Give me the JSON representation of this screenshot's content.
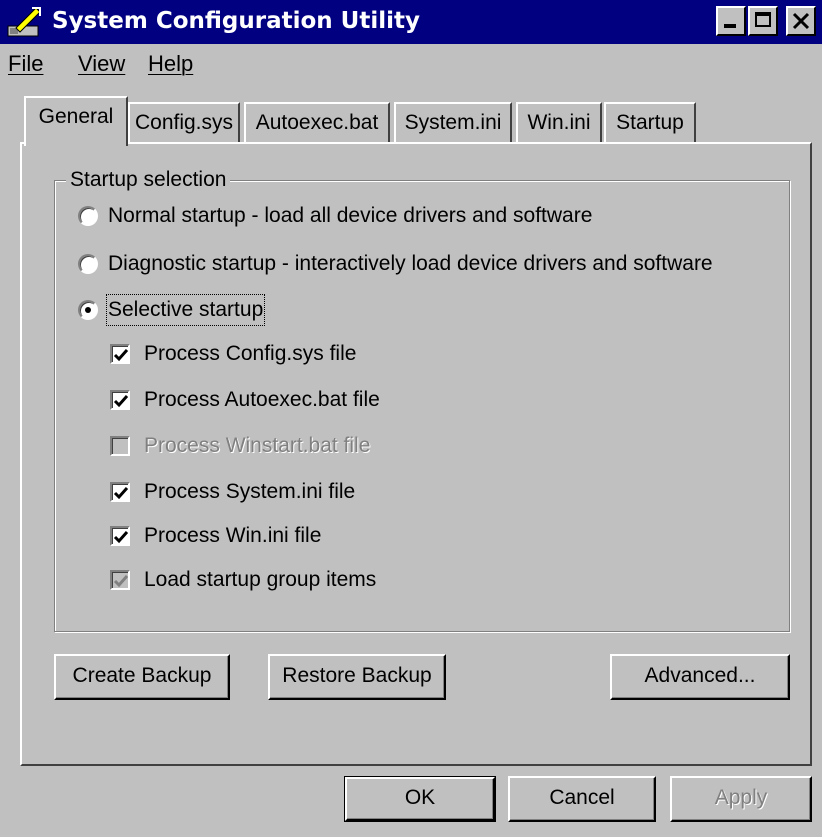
{
  "window": {
    "title": "System Configuration Utility"
  },
  "menu": {
    "file": "File",
    "view": "View",
    "help": "Help"
  },
  "tabs": [
    "General",
    "Config.sys",
    "Autoexec.bat",
    "System.ini",
    "Win.ini",
    "Startup"
  ],
  "active_tab": "General",
  "startup_selection": {
    "title": "Startup selection",
    "options": [
      {
        "label": "Normal startup - load all device drivers and software",
        "selected": false
      },
      {
        "label": "Diagnostic startup - interactively load device drivers and software",
        "selected": false
      },
      {
        "label": "Selective startup",
        "selected": true
      }
    ],
    "checks": [
      {
        "label": "Process Config.sys file",
        "checked": true,
        "enabled": true
      },
      {
        "label": "Process Autoexec.bat file",
        "checked": true,
        "enabled": true
      },
      {
        "label": "Process Winstart.bat file",
        "checked": false,
        "enabled": false
      },
      {
        "label": "Process System.ini file",
        "checked": true,
        "enabled": true
      },
      {
        "label": "Process Win.ini file",
        "checked": true,
        "enabled": true
      },
      {
        "label": "Load startup group items",
        "checked": true,
        "enabled": false
      }
    ]
  },
  "buttons": {
    "create_backup": "Create Backup",
    "restore_backup": "Restore Backup",
    "advanced": "Advanced...",
    "ok": "OK",
    "cancel": "Cancel",
    "apply": "Apply"
  }
}
